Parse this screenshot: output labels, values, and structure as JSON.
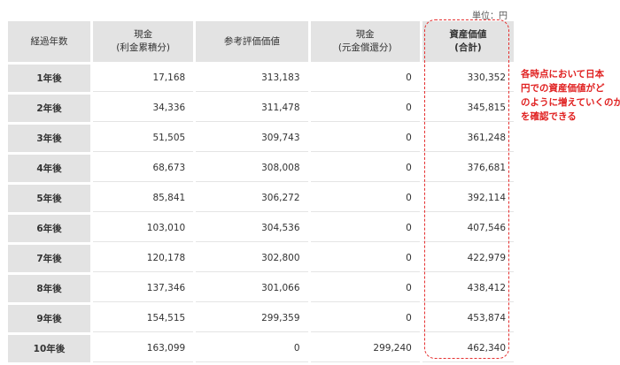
{
  "unit_label": "単位：円",
  "table": {
    "headers": [
      {
        "line1": "経過年数",
        "line2": ""
      },
      {
        "line1": "現金",
        "line2": "(利金累積分)"
      },
      {
        "line1": "参考評価価値",
        "line2": ""
      },
      {
        "line1": "現金",
        "line2": "(元金償還分)"
      },
      {
        "line1": "資産価値",
        "line2": "(合計)"
      }
    ],
    "rows": [
      {
        "year": "1年後",
        "cash_interest": "17,168",
        "ref_value": "313,183",
        "cash_principal": "0",
        "total": "330,352"
      },
      {
        "year": "2年後",
        "cash_interest": "34,336",
        "ref_value": "311,478",
        "cash_principal": "0",
        "total": "345,815"
      },
      {
        "year": "3年後",
        "cash_interest": "51,505",
        "ref_value": "309,743",
        "cash_principal": "0",
        "total": "361,248"
      },
      {
        "year": "4年後",
        "cash_interest": "68,673",
        "ref_value": "308,008",
        "cash_principal": "0",
        "total": "376,681"
      },
      {
        "year": "5年後",
        "cash_interest": "85,841",
        "ref_value": "306,272",
        "cash_principal": "0",
        "total": "392,114"
      },
      {
        "year": "6年後",
        "cash_interest": "103,010",
        "ref_value": "304,536",
        "cash_principal": "0",
        "total": "407,546"
      },
      {
        "year": "7年後",
        "cash_interest": "120,178",
        "ref_value": "302,800",
        "cash_principal": "0",
        "total": "422,979"
      },
      {
        "year": "8年後",
        "cash_interest": "137,346",
        "ref_value": "301,066",
        "cash_principal": "0",
        "total": "438,412"
      },
      {
        "year": "9年後",
        "cash_interest": "154,515",
        "ref_value": "299,359",
        "cash_principal": "0",
        "total": "453,874"
      },
      {
        "year": "10年後",
        "cash_interest": "163,099",
        "ref_value": "0",
        "cash_principal": "299,240",
        "total": "462,340"
      }
    ]
  },
  "callout": {
    "lines": [
      "各時点において日本",
      "円での資産価値がど",
      "のように増えていくのか",
      "を確認できる"
    ]
  },
  "colors": {
    "header_bg": "#e3e3e3",
    "highlight": "#e53030",
    "callout_text": "#e02020"
  }
}
